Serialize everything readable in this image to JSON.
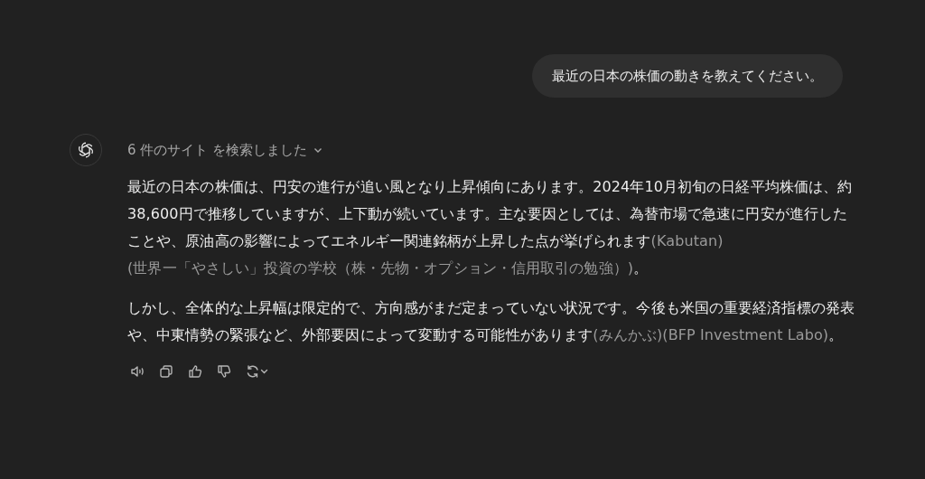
{
  "user_message": "最近の日本の株価の動きを教えてください。",
  "assistant": {
    "search_summary": {
      "label": "6 件のサイト を検索しました",
      "expanded": false
    },
    "paragraphs": [
      {
        "segments": [
          {
            "kind": "text",
            "text": "最近の日本の株価は、円安の進行が追い風となり上昇傾向にあります。2024年10月初旬の日経平均株価は、約38,600円で推移していますが、上下動が続いています。主な要因としては、為替市場で急速に円安が進行したことや、原油高の影響によってエネルギー関連銘柄が上昇した点が挙げられます"
          },
          {
            "kind": "citation",
            "text": "(Kabutan)"
          },
          {
            "kind": "citation",
            "text": "(世界一「やさしい」投資の学校（株・先物・オプション・信用取引の勉強）)"
          },
          {
            "kind": "text",
            "text": "。"
          }
        ]
      },
      {
        "segments": [
          {
            "kind": "text",
            "text": "しかし、全体的な上昇幅は限定的で、方向感がまだ定まっていない状況です。今後も米国の重要経済指標の発表や、中東情勢の緊張など、外部要因によって変動する可能性があります"
          },
          {
            "kind": "citation",
            "text": "(みんかぶ)"
          },
          {
            "kind": "citation",
            "text": "(BFP Investment Labo)"
          },
          {
            "kind": "text",
            "text": "。"
          }
        ]
      }
    ]
  }
}
